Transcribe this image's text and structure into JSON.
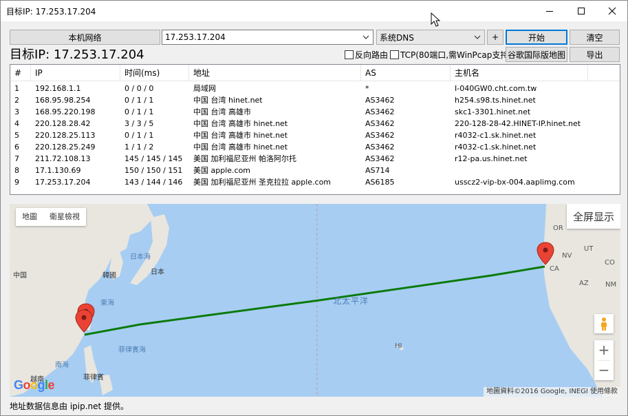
{
  "window": {
    "title": "目标IP: 17.253.17.204"
  },
  "toolbar": {
    "local_network_label": "本机网络",
    "target_input_value": "17.253.17.204",
    "dns_select_value": "系统DNS",
    "add_label": "+",
    "start_label": "开始",
    "clear_label": "清空",
    "google_map_label": "谷歌国际版地图",
    "export_label": "导出"
  },
  "target": {
    "label": "目标IP: 17.253.17.204"
  },
  "options": {
    "reverse_route_label": "反向路由",
    "tcp_label": "TCP(80端口,需WinPcap支持)"
  },
  "table": {
    "headers": [
      "#",
      "IP",
      "时间(ms)",
      "地址",
      "AS",
      "主机名"
    ],
    "rows": [
      {
        "num": "1",
        "ip": "192.168.1.1",
        "time": "0 / 0 / 0",
        "addr": "局域网",
        "as": "*",
        "host": "I-040GW0.cht.com.tw"
      },
      {
        "num": "2",
        "ip": "168.95.98.254",
        "time": "0 / 1 / 1",
        "addr": "中国 台湾 hinet.net",
        "as": "AS3462",
        "host": "h254.s98.ts.hinet.net"
      },
      {
        "num": "3",
        "ip": "168.95.220.198",
        "time": "0 / 1 / 1",
        "addr": "中国 台湾 高雄市",
        "as": "AS3462",
        "host": "skc1-3301.hinet.net"
      },
      {
        "num": "4",
        "ip": "220.128.28.42",
        "time": "3 / 3 / 5",
        "addr": "中国 台湾 高雄市 hinet.net",
        "as": "AS3462",
        "host": "220-128-28-42.HINET-IP.hinet.net"
      },
      {
        "num": "5",
        "ip": "220.128.25.113",
        "time": "0 / 1 / 1",
        "addr": "中国 台湾 高雄市 hinet.net",
        "as": "AS3462",
        "host": "r4032-c1.sk.hinet.net"
      },
      {
        "num": "6",
        "ip": "220.128.25.249",
        "time": "1 / 1 / 2",
        "addr": "中国 台湾 高雄市 hinet.net",
        "as": "AS3462",
        "host": "r4032-c1.sk.hinet.net"
      },
      {
        "num": "7",
        "ip": "211.72.108.13",
        "time": "145 / 145 / 145",
        "addr": "美国 加利福尼亚州 帕洛阿尔托",
        "as": "AS3462",
        "host": "r12-pa.us.hinet.net"
      },
      {
        "num": "8",
        "ip": "17.1.130.69",
        "time": "150 / 150 / 151",
        "addr": "美国 apple.com",
        "as": "AS714",
        "host": ""
      },
      {
        "num": "9",
        "ip": "17.253.17.204",
        "time": "143 / 144 / 146",
        "addr": "美国 加利福尼亚州 圣克拉拉 apple.com",
        "as": "AS6185",
        "host": "ussc z2-vip-bx-004.aaplimg.com"
      }
    ]
  },
  "map": {
    "map_tab": "地圖",
    "satellite_tab": "衛星檢視",
    "fullscreen_label": "全屏显示",
    "zoom_in": "+",
    "zoom_out": "−",
    "attribution": "地圖資料©2016 Google, INEGI   使用條款",
    "logo": "Google",
    "labels": {
      "china": "中国",
      "japan_sea": "日本海",
      "japan": "日本",
      "korea": "韓國",
      "east_sea": "東海",
      "pacific": "北太平洋",
      "philippine_sea": "菲律賓海",
      "south_sea": "南海",
      "vietnam": "越南",
      "philippines": "菲律賓",
      "hi": "HI",
      "or": "OR",
      "nv": "NV",
      "ca": "CA",
      "ut": "UT",
      "co": "CO",
      "az": "AZ",
      "nm": "NM"
    },
    "route_color": "#0a7a0a"
  },
  "status": {
    "text": "地址数据信息由 ipip.net 提供。"
  }
}
